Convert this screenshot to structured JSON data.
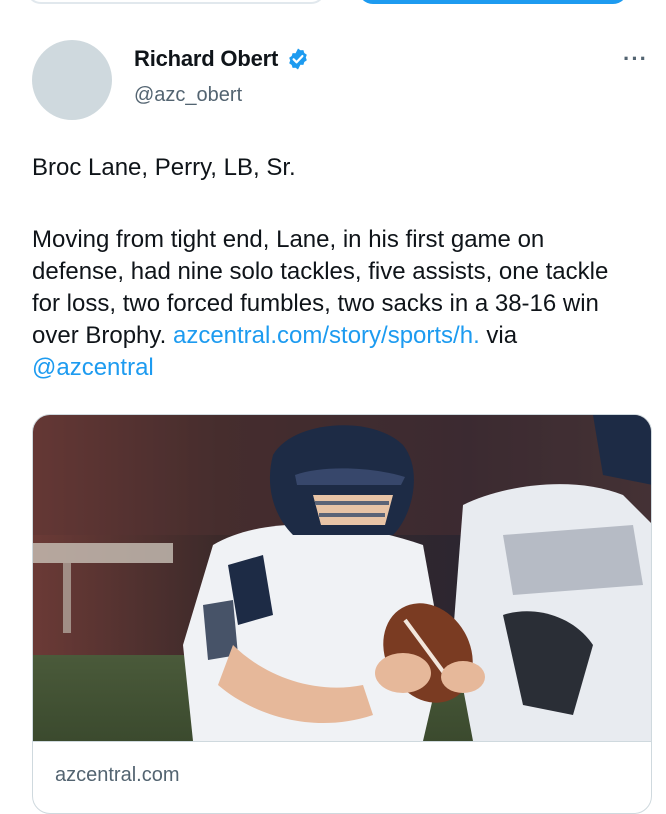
{
  "author": {
    "display_name": "Richard Obert",
    "handle": "@azc_obert",
    "verified": true
  },
  "tweet": {
    "line1": "Broc Lane, Perry, LB, Sr.",
    "body": "Moving from tight end, Lane, in his first game on defense, had nine solo tackles, five assists, one tackle for loss, two forced fumbles, two sacks in a 38-16 win over Brophy.",
    "link_text": "azcentral.com/story/sports/h.",
    "via_text": " via ",
    "mention": "@azcentral"
  },
  "card": {
    "domain": "azcentral.com"
  },
  "icons": {
    "verified": "verified-badge-icon",
    "more": "more-options-icon"
  },
  "colors": {
    "link": "#1d9bf0",
    "muted": "#536471",
    "verified": "#1d9bf0"
  }
}
